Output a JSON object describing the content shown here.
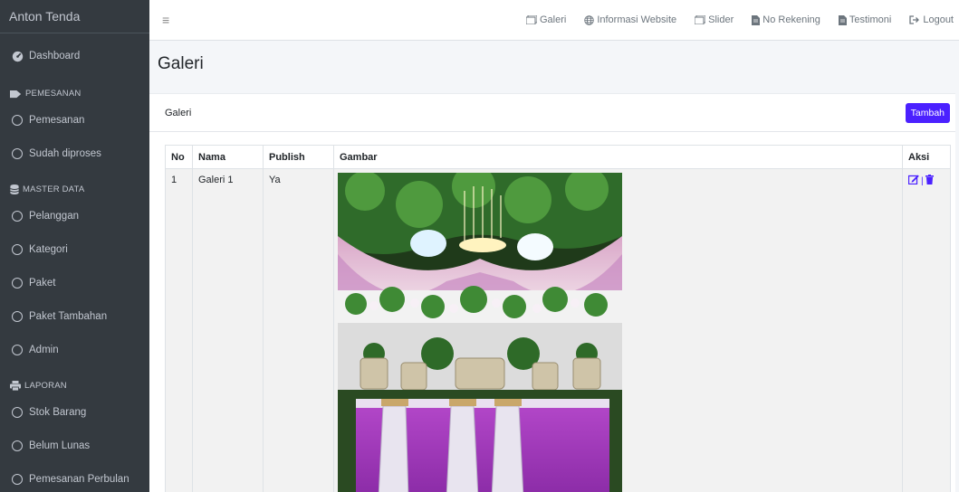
{
  "brand": "Anton Tenda",
  "sidebar": {
    "dashboard": "Dashboard",
    "sections": [
      {
        "header": "PEMESANAN",
        "items": [
          "Pemesanan",
          "Sudah diproses"
        ]
      },
      {
        "header": "MASTER DATA",
        "items": [
          "Pelanggan",
          "Kategori",
          "Paket",
          "Paket Tambahan",
          "Admin"
        ]
      },
      {
        "header": "LAPORAN",
        "items": [
          "Stok Barang",
          "Belum Lunas",
          "Pemesanan Perbulan"
        ]
      }
    ]
  },
  "topbar": {
    "menu_icon": "hamburger-icon",
    "links": [
      "Galeri",
      "Informasi Website",
      "Slider",
      "No Rekening",
      "Testimoni",
      "Logout"
    ]
  },
  "page": {
    "title": "Galeri",
    "card_title": "Galeri",
    "add_button": "Tambah"
  },
  "table": {
    "headers": [
      "No",
      "Nama",
      "Publish",
      "Gambar",
      "Aksi"
    ],
    "rows": [
      {
        "no": "1",
        "nama": "Galeri 1",
        "publish": "Ya",
        "gambar": "wedding-decoration-photo",
        "aksi": [
          "edit-icon",
          "delete-icon"
        ]
      }
    ]
  },
  "colors": {
    "sidebar_bg": "#343a40",
    "accent": "#4b21ff",
    "content_bg": "#f4f6f9"
  }
}
